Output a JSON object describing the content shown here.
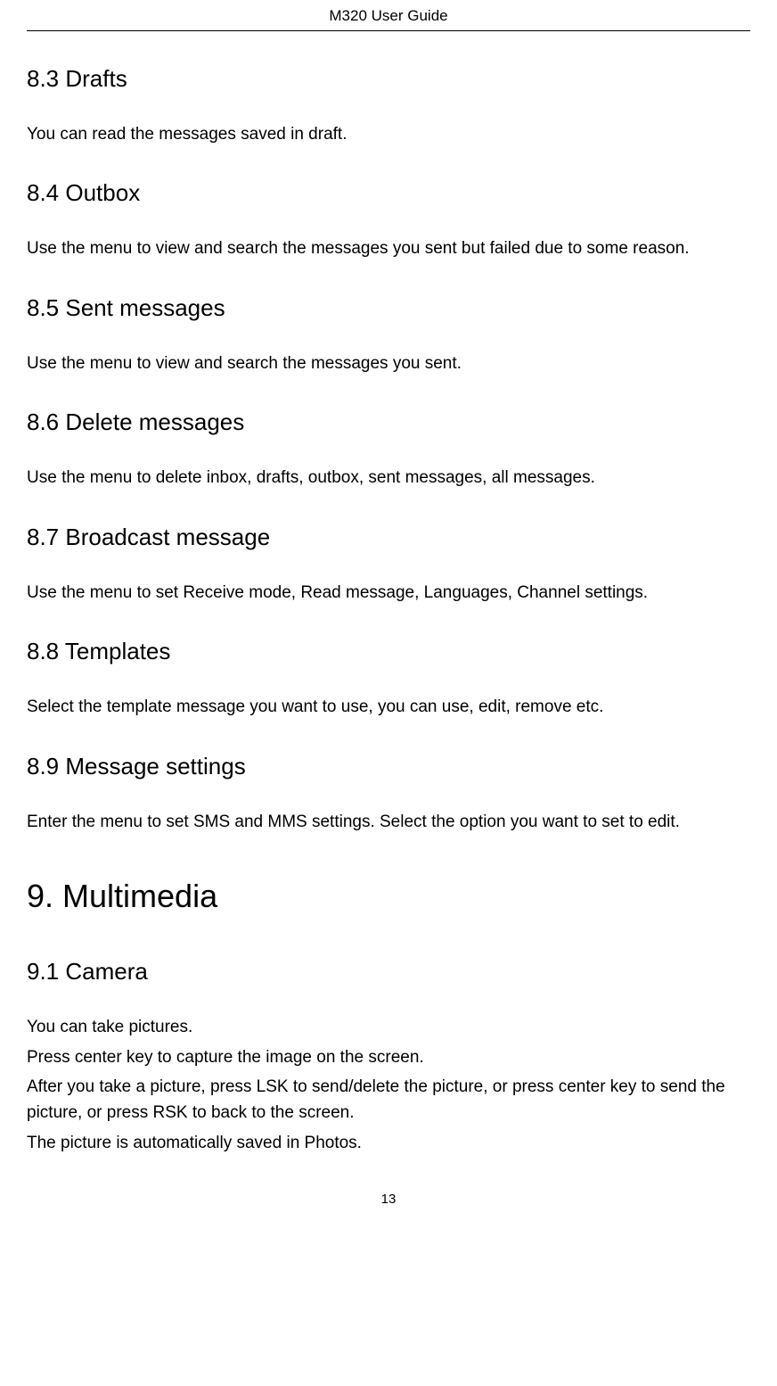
{
  "header": {
    "title": "M320 User Guide"
  },
  "sections": {
    "s83": {
      "heading": "8.3 Drafts",
      "body": "You can read the messages saved in draft."
    },
    "s84": {
      "heading": "8.4 Outbox",
      "body": "Use the menu to view and search the messages you sent but failed due to some reason."
    },
    "s85": {
      "heading": "8.5 Sent messages",
      "body": "Use the menu to view and search the messages you sent."
    },
    "s86": {
      "heading": "8.6 Delete messages",
      "body": "Use the menu to delete inbox, drafts, outbox, sent messages, all messages."
    },
    "s87": {
      "heading": "8.7 Broadcast message",
      "body": "Use the menu to set Receive mode, Read message, Languages, Channel settings."
    },
    "s88": {
      "heading": "8.8 Templates",
      "body": "Select the template message you want to use, you can use, edit, remove etc."
    },
    "s89": {
      "heading": "8.9 Message settings",
      "body": "Enter the menu to set SMS and MMS settings. Select the option you want to set to edit."
    },
    "chapter9": {
      "heading": "9. Multimedia"
    },
    "s91": {
      "heading": "9.1 Camera",
      "line1": "You can take pictures.",
      "line2": "Press center key to capture the image on the screen.",
      "line3": "After you take a picture, press LSK to send/delete the picture, or press center key to send the picture, or press RSK to back to the screen.",
      "line4": "The picture is automatically saved in Photos."
    }
  },
  "footer": {
    "page_number": "13"
  }
}
